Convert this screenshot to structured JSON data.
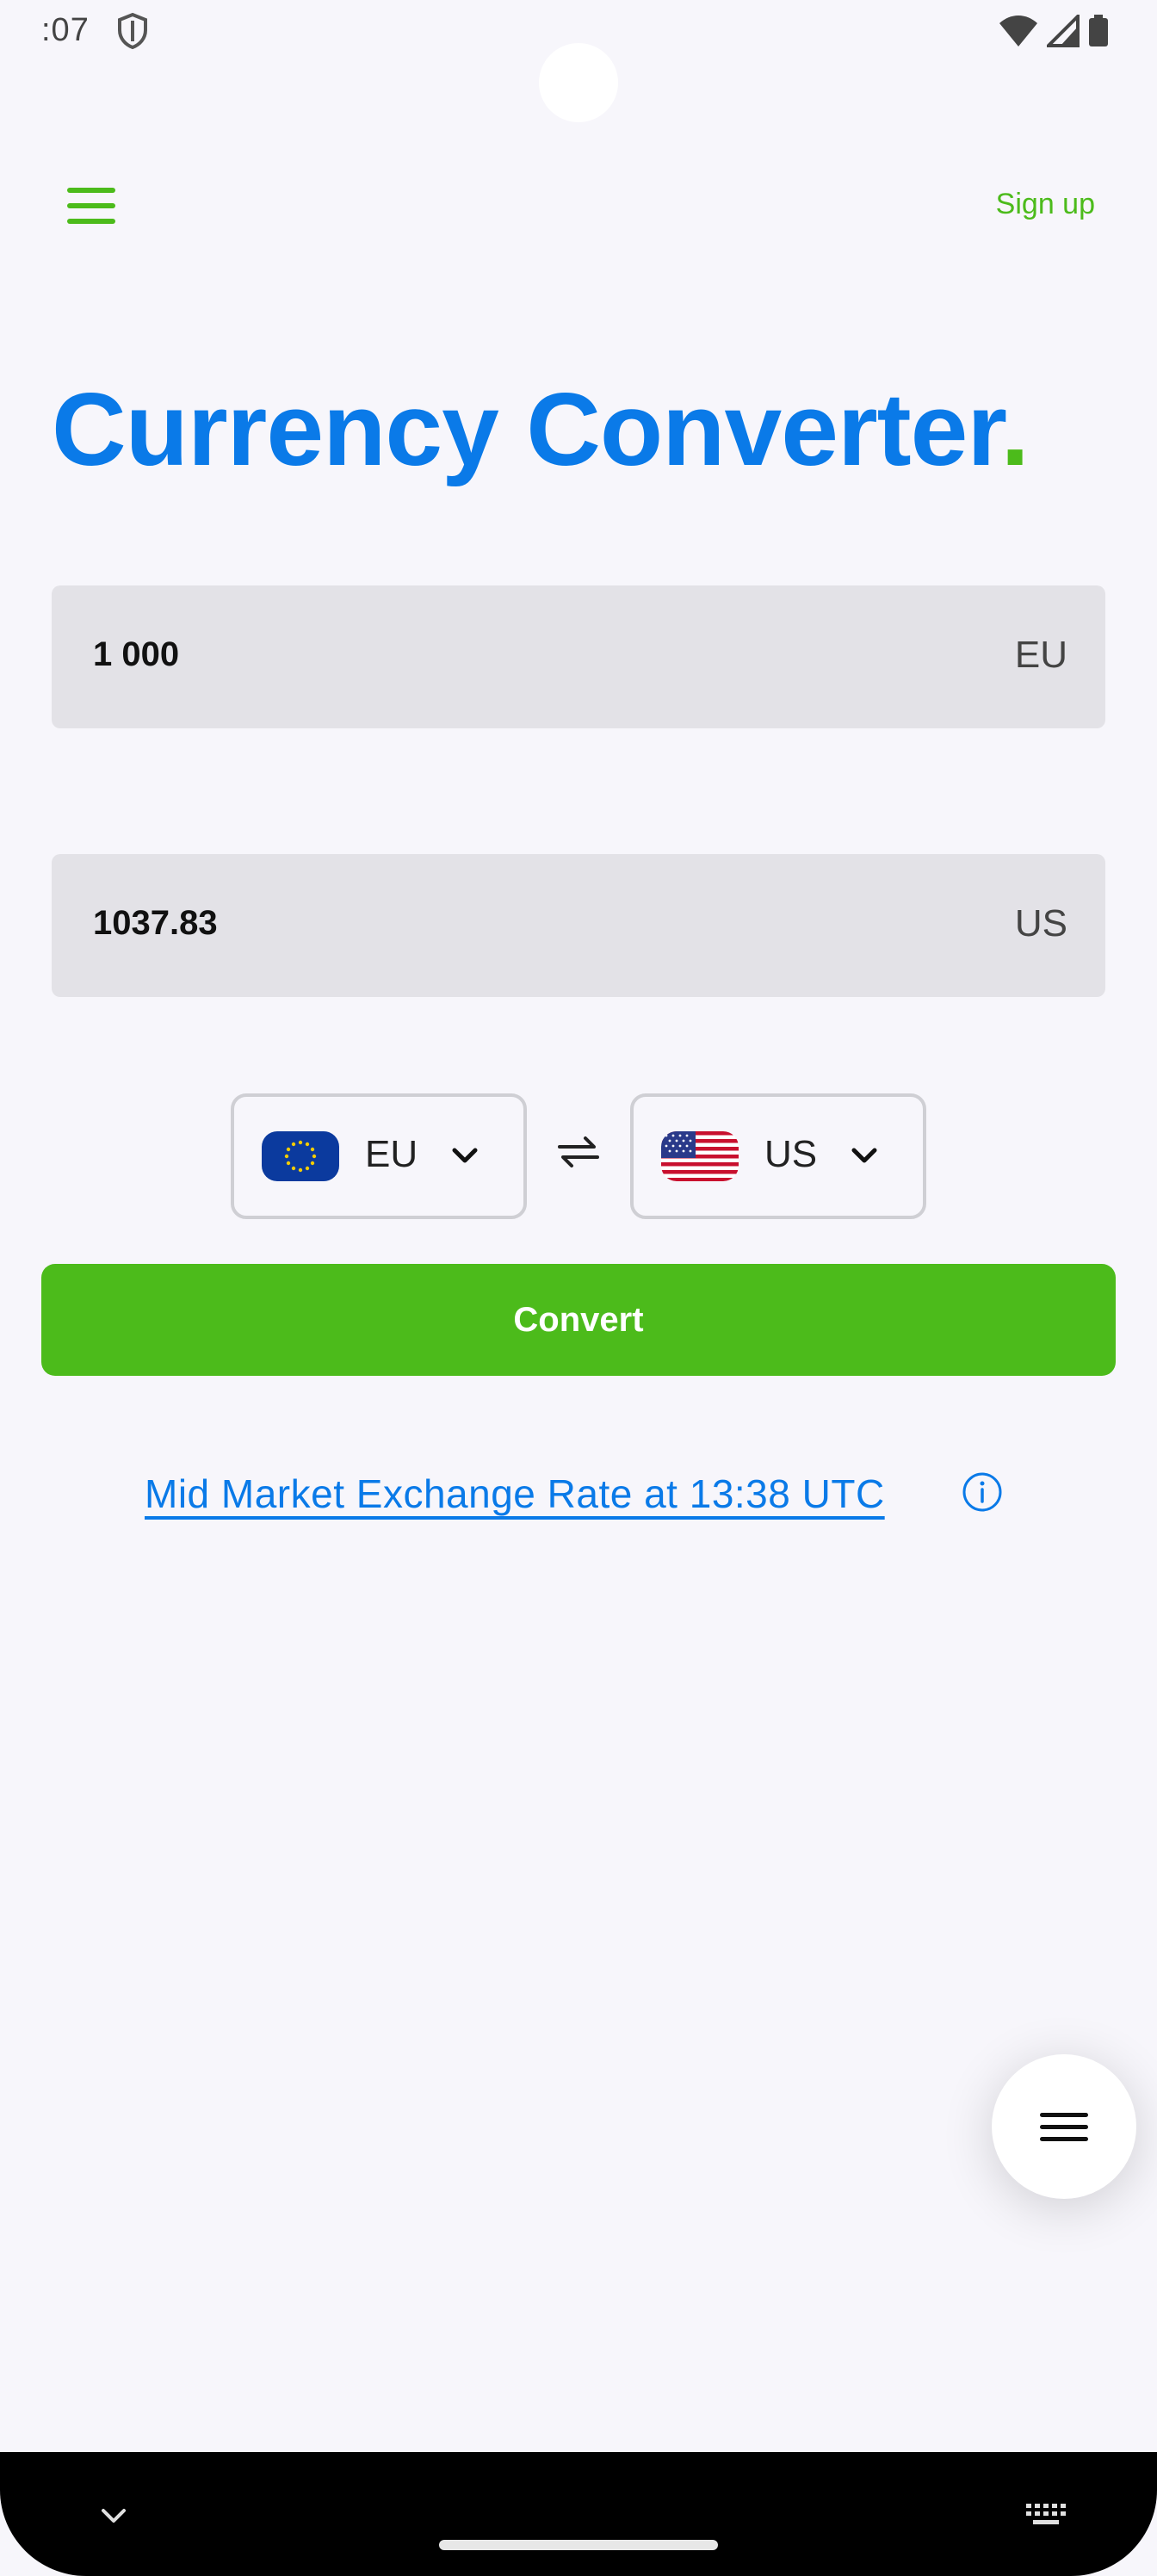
{
  "status_bar": {
    "time": ":07"
  },
  "header": {
    "signup_label": "Sign up"
  },
  "title": {
    "text": "Currency Converter",
    "dot": "."
  },
  "from_field": {
    "value": "1 000",
    "unit": "EU"
  },
  "to_field": {
    "value": "1037.83",
    "unit": "US"
  },
  "from_select": {
    "code": "EU",
    "flag": "eu-flag"
  },
  "to_select": {
    "code": "US",
    "flag": "us-flag"
  },
  "swap": {
    "glyph": "⇌"
  },
  "convert_label": "Convert",
  "rate_link": "Mid Market Exchange Rate at 13:38 UTC",
  "colors": {
    "brand_blue": "#0a7ae8",
    "brand_green": "#4cbb1b",
    "field_bg": "#e3e2e7",
    "page_bg": "#f7f6fb"
  }
}
